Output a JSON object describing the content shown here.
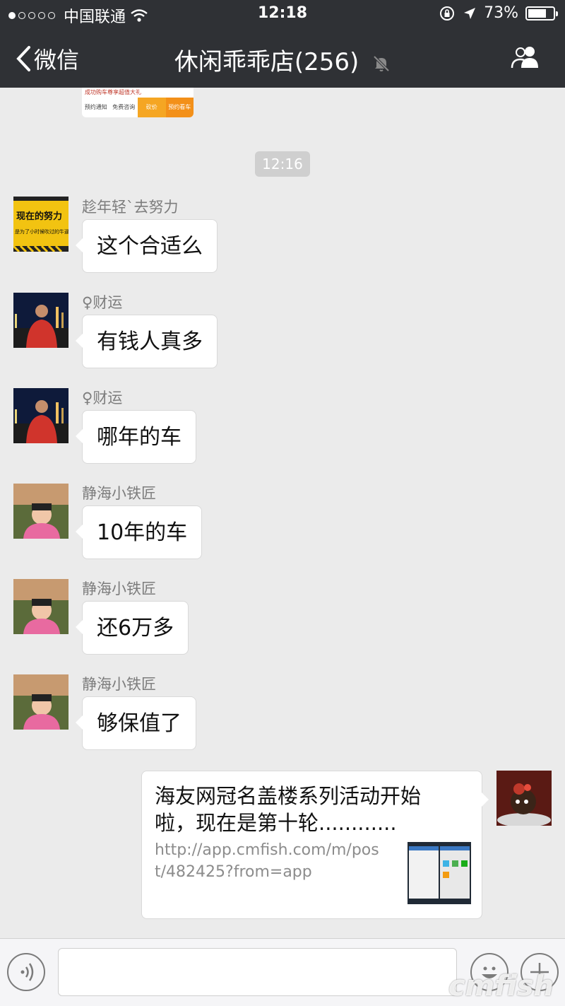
{
  "status_bar": {
    "carrier": "中国联通",
    "time": "12:18",
    "battery": "73%",
    "battery_level": 0.73
  },
  "nav": {
    "back_label": "微信",
    "title": "休闲乖乖店(256)",
    "muted": true
  },
  "previous_card": {
    "headline": "成功购车尊享超值大礼",
    "buttons": [
      "预约通知",
      "免费咨询",
      "砍价",
      "预约看车"
    ]
  },
  "timestamp": "12:16",
  "messages": [
    {
      "sender": "趁年轻`去努力",
      "text": "这个合适么",
      "avatar_text": "现在的努力",
      "avatar_sub": "是为了小时候吹过的牛逼"
    },
    {
      "sender": "♀财运",
      "text": "有钱人真多"
    },
    {
      "sender": "♀财运",
      "text": "哪年的车"
    },
    {
      "sender": "静海小铁匠",
      "text": "10年的车"
    },
    {
      "sender": "静海小铁匠",
      "text": "还6万多"
    },
    {
      "sender": "静海小铁匠",
      "text": "够保值了"
    }
  ],
  "link_message": {
    "title": "海友网冠名盖楼系列活动开始啦，现在是第十轮............",
    "url": "http://app.cmfish.com/m/post/482425?from=app"
  },
  "input_bar": {
    "placeholder": ""
  },
  "watermark": "cmfish",
  "colors": {
    "topbar": "#2f3135",
    "chat_bg": "#ebebeb",
    "bubble": "#ffffff",
    "timestamp_bg": "#cfcfcf"
  }
}
